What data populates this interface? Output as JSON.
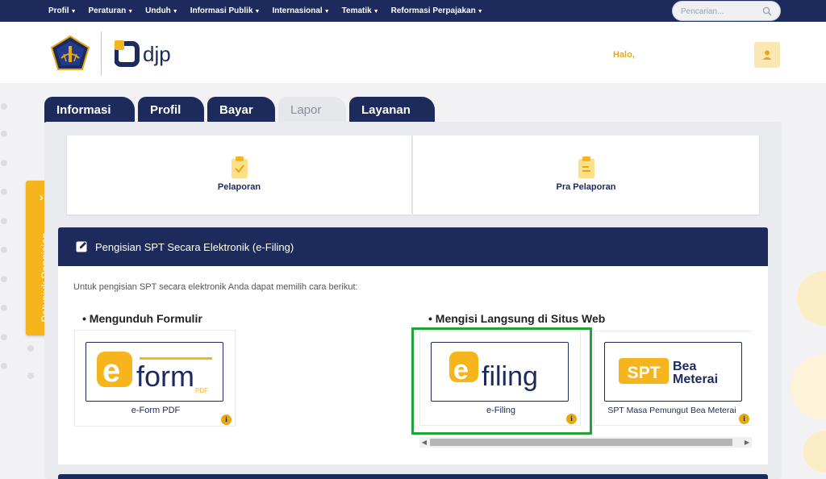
{
  "nav": {
    "items": [
      {
        "label": "Profil"
      },
      {
        "label": "Peraturan"
      },
      {
        "label": "Unduh"
      },
      {
        "label": "Informasi Publik"
      },
      {
        "label": "Internasional"
      },
      {
        "label": "Tematik"
      },
      {
        "label": "Reformasi Perpajakan"
      }
    ],
    "search_placeholder": "Pencarian..."
  },
  "header": {
    "brand": "djp",
    "greeting": "Halo,"
  },
  "side_tab": {
    "label": "Petunjuk Pengisian"
  },
  "tabs": [
    {
      "label": "Informasi",
      "active": false
    },
    {
      "label": "Profil",
      "active": false
    },
    {
      "label": "Bayar",
      "active": false
    },
    {
      "label": "Lapor",
      "active": true
    },
    {
      "label": "Layanan",
      "active": false
    }
  ],
  "cards": [
    {
      "label": "Pelaporan",
      "icon": "clipboard-check-icon"
    },
    {
      "label": "Pra Pelaporan",
      "icon": "clipboard-list-icon"
    }
  ],
  "efiling": {
    "title": "Pengisian SPT Secara Elektronik (e-Filing)",
    "intro": "Untuk pengisian SPT secara elektronik Anda dapat memilih cara berikut:",
    "section_download": "Mengunduh Formulir",
    "section_web": "Mengisi Langsung di Situs Web",
    "items": {
      "eform": {
        "logo_main": "form",
        "logo_sub": "PDF",
        "caption": "e-Form PDF"
      },
      "efiling": {
        "logo_main": "filing",
        "caption": "e-Filing"
      },
      "spt": {
        "logo_badge": "SPT",
        "logo_line1": "Bea",
        "logo_line2": "Meterai",
        "caption": "SPT Masa Pemungut Bea Meterai"
      }
    }
  },
  "colors": {
    "navy": "#1d2a5c",
    "gold": "#f6b51d",
    "highlight": "#21a33a"
  }
}
